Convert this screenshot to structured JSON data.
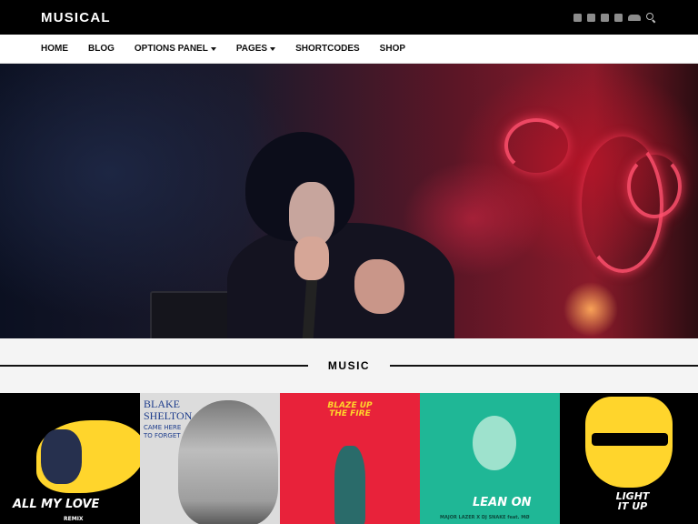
{
  "header": {
    "logo": "MUSICAL",
    "social_icons": [
      "facebook-icon",
      "twitter-icon",
      "instagram-icon",
      "youtube-icon",
      "soundcloud-icon",
      "search-icon"
    ]
  },
  "nav": {
    "items": [
      {
        "label": "HOME",
        "has_dropdown": false
      },
      {
        "label": "BLOG",
        "has_dropdown": false
      },
      {
        "label": "OPTIONS PANEL",
        "has_dropdown": true
      },
      {
        "label": "PAGES",
        "has_dropdown": true
      },
      {
        "label": "SHORTCODES",
        "has_dropdown": false
      },
      {
        "label": "SHOP",
        "has_dropdown": false
      }
    ]
  },
  "section": {
    "title": "MUSIC"
  },
  "albums": [
    {
      "title": "ALL MY LOVE",
      "subtitle": "REMIX"
    },
    {
      "title": "BLAKE SHELTON",
      "subtitle": "CAME HERE TO FORGET"
    },
    {
      "title": "BLAZE UP THE FIRE",
      "subtitle": ""
    },
    {
      "title": "LEAN ON",
      "subtitle": "MAJOR LAZER X DJ SNAKE feat. MØ"
    },
    {
      "title": "LIGHT IT UP",
      "subtitle": ""
    }
  ],
  "colors": {
    "topbar": "#000000",
    "nav_bg": "#ffffff",
    "page_bg": "#f4f4f4"
  }
}
